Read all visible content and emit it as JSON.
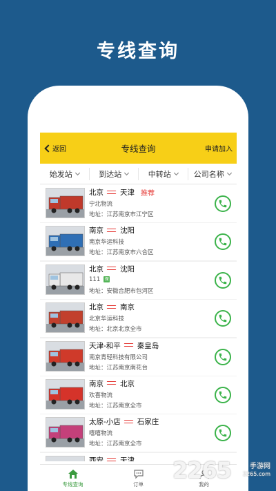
{
  "hero": {
    "title": "专线查询"
  },
  "nav": {
    "back_label": "返回",
    "title": "专线查询",
    "apply_label": "申请加入"
  },
  "filters": [
    {
      "label": "始发站"
    },
    {
      "label": "到达站"
    },
    {
      "label": "中转站"
    },
    {
      "label": "公司名称"
    }
  ],
  "items": [
    {
      "from": "北京",
      "to": "天津",
      "tag": "推荐",
      "company": "宁北物流",
      "address": "地址：江苏南京市江宁区",
      "verified": false,
      "truck_color": "#c0392b"
    },
    {
      "from": "南京",
      "to": "沈阳",
      "tag": "",
      "company": "南京华运科技",
      "address": "地址：江苏南京市六合区",
      "verified": false,
      "truck_color": "#2f6fb5"
    },
    {
      "from": "北京",
      "to": "沈阳",
      "tag": "",
      "company": "111",
      "address": "地址：安徽合肥市包河区",
      "verified": true,
      "verified_label": "保",
      "truck_color": "#e8e8e8"
    },
    {
      "from": "北京",
      "to": "南京",
      "tag": "",
      "company": "北京华运科技",
      "address": "地址：北京北京全市",
      "verified": false,
      "truck_color": "#c2402d"
    },
    {
      "from": "天津-和平",
      "to": "秦皇岛",
      "tag": "",
      "company": "南京青轻科技有限公司",
      "address": "地址：江苏南京南花台",
      "verified": false,
      "truck_color": "#cf3a2a"
    },
    {
      "from": "南京",
      "to": "北京",
      "tag": "",
      "company": "欢喜物流",
      "address": "地址：江苏南京全市",
      "verified": false,
      "truck_color": "#d5332a"
    },
    {
      "from": "太原-小店",
      "to": "石家庄",
      "tag": "",
      "company": "嘻嘻物流",
      "address": "地址：江苏南京全市",
      "verified": false,
      "truck_color": "#c4407a"
    },
    {
      "from": "西安",
      "to": "天津",
      "tag": "",
      "company": "",
      "address": "",
      "verified": false,
      "truck_color": "#3a7ab8"
    }
  ],
  "tabbar": [
    {
      "label": "专线查询",
      "active": true
    },
    {
      "label": "订单",
      "active": false
    },
    {
      "label": "我的",
      "active": false
    }
  ],
  "watermark": {
    "number": "2265",
    "site": "手游网",
    "url": "2265.com"
  },
  "colors": {
    "background": "#1d5a8c",
    "nav": "#f7cf17",
    "accent_red": "#e53935",
    "call_green": "#3bb34a"
  }
}
